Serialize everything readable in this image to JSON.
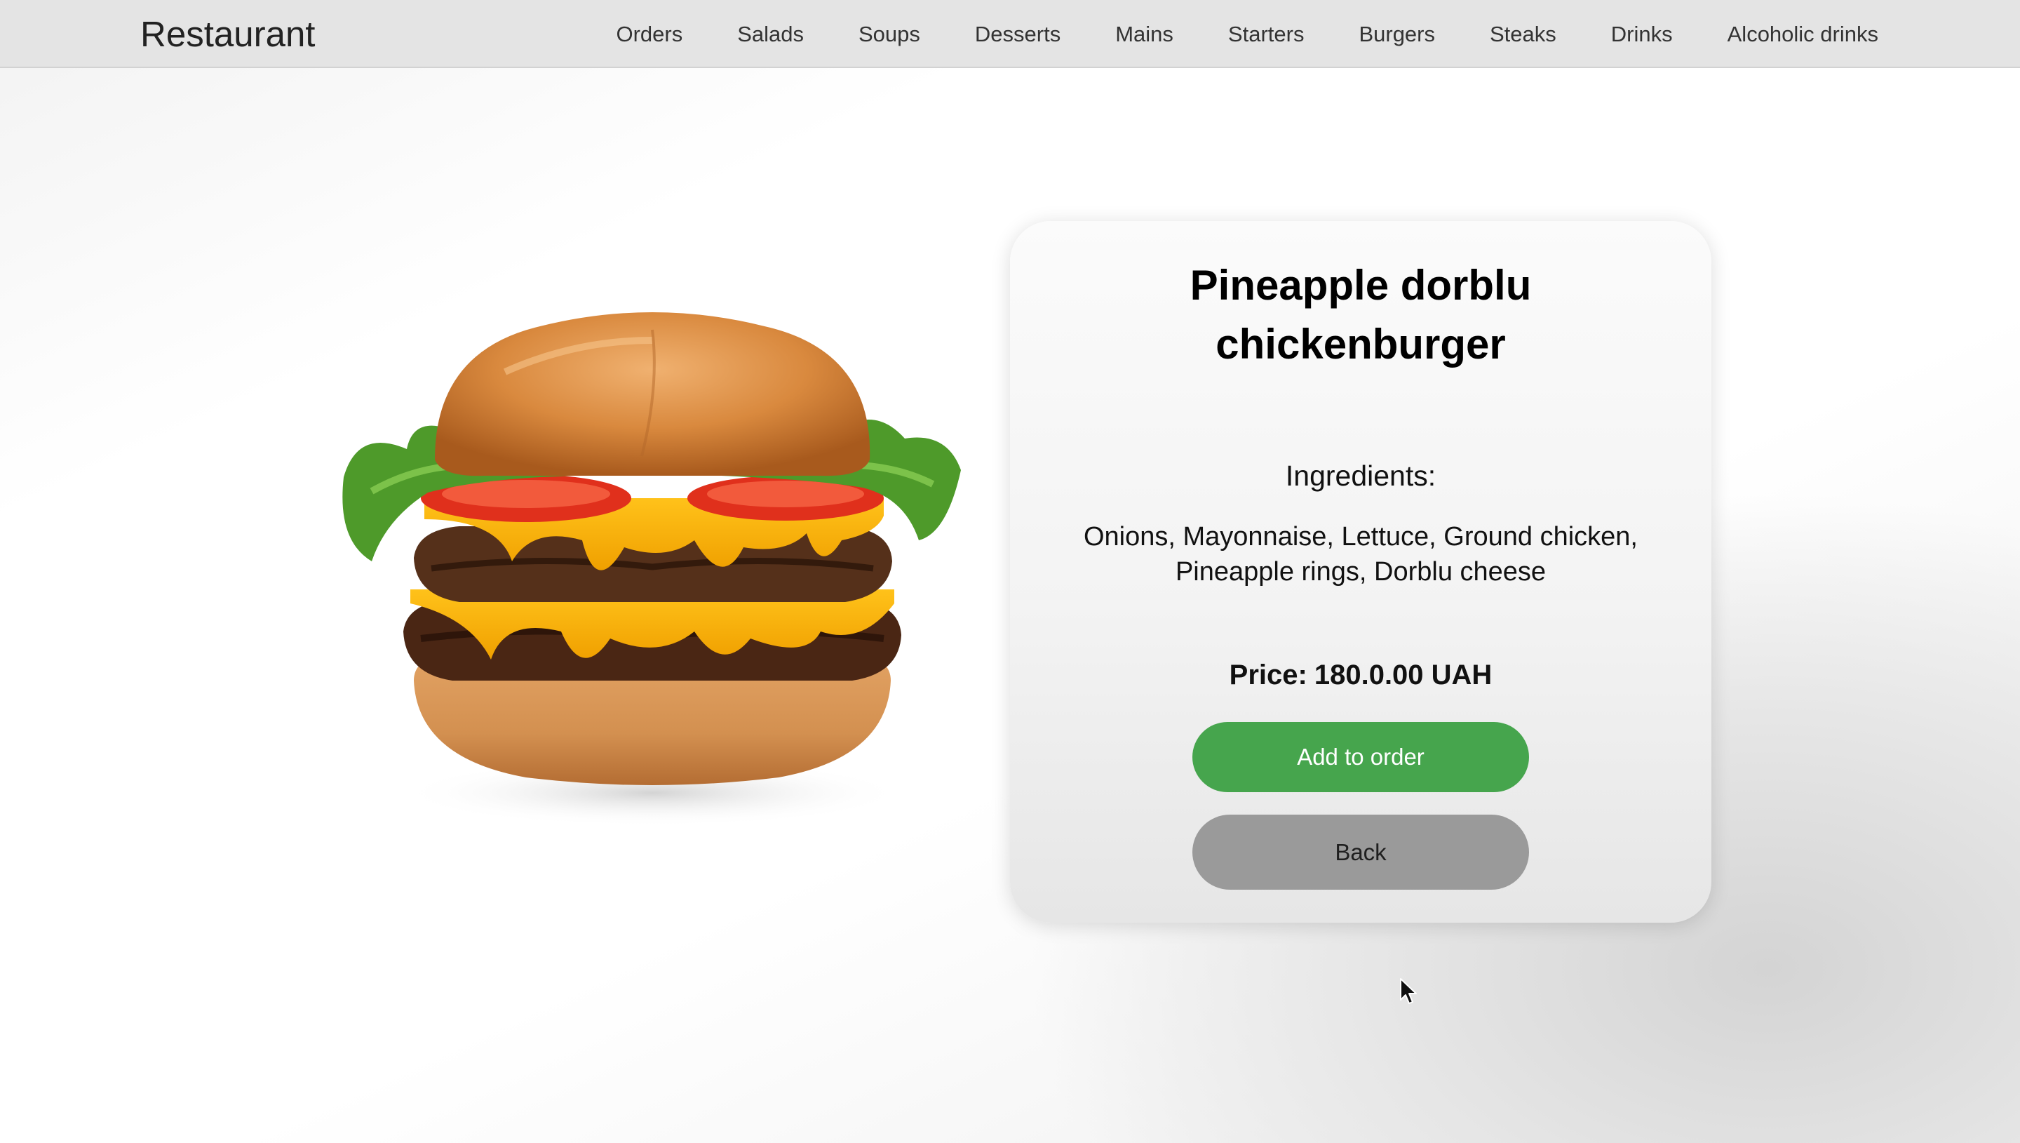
{
  "header": {
    "brand": "Restaurant",
    "nav": [
      "Orders",
      "Salads",
      "Soups",
      "Desserts",
      "Mains",
      "Starters",
      "Burgers",
      "Steaks",
      "Drinks",
      "Alcoholic drinks"
    ]
  },
  "product": {
    "name": "Pineapple dorblu chickenburger",
    "image_icon": "burger-photo",
    "ingredients_label": "Ingredients:",
    "ingredients": "Onions, Mayonnaise, Lettuce, Ground chicken, Pineapple rings, Dorblu cheese",
    "price_label": "Price:",
    "price_value": "180.0.00 UAH"
  },
  "actions": {
    "add_label": "Add to order",
    "back_label": "Back"
  },
  "colors": {
    "add_button": "#46a54d",
    "back_button": "#9a9a9a",
    "navbar": "#e4e4e4"
  }
}
